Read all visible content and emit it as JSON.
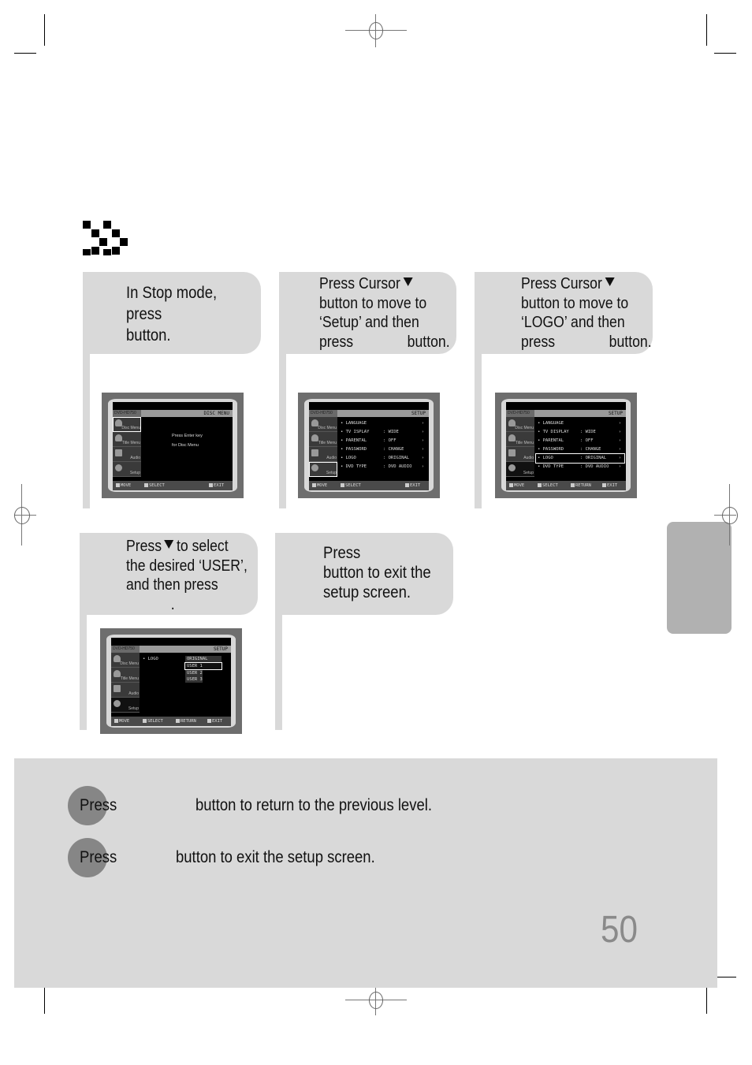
{
  "section_icon": "double-chevron-right-icon",
  "steps": [
    {
      "lines": [
        "In Stop mode,",
        "press",
        "button."
      ],
      "screen": {
        "brand": "DVD-HD750",
        "title": "DISC MENU",
        "sidebar": [
          "Disc Menu",
          "Title Menu",
          "Audio",
          "Setup"
        ],
        "selected_sidebar": "Disc Menu",
        "message": [
          "Press Enter key",
          "for Disc Menu"
        ],
        "footer": [
          "MOVE",
          "SELECT",
          "EXIT"
        ]
      }
    },
    {
      "lines": [
        "Press Cursor",
        "button to move to",
        "‘Setup’ and then",
        "press              button."
      ],
      "arrow": "down-triangle-icon",
      "screen": {
        "brand": "DVD-HD750",
        "title": "SETUP",
        "sidebar": [
          "Disc Menu",
          "Title Menu",
          "Audio",
          "Setup"
        ],
        "selected_sidebar": "Setup",
        "rows": [
          {
            "label": "LANGUAGE",
            "value": ""
          },
          {
            "label": "TV  ISPLAY",
            "value": "WIDE"
          },
          {
            "label": "PARENTAL",
            "value": "OFF"
          },
          {
            "label": "PASSWORD",
            "value": "CHANGE"
          },
          {
            "label": "LOGO",
            "value": "ORIGINAL"
          },
          {
            "label": "DVD TYPE",
            "value": "DVD AUDIO"
          }
        ],
        "footer": [
          "MOVE",
          "SELECT",
          "EXIT"
        ]
      }
    },
    {
      "lines": [
        "Press Cursor",
        "button to move to",
        "‘LOGO’ and then",
        "press              button."
      ],
      "arrow": "down-triangle-icon",
      "screen": {
        "brand": "DVD-HD750",
        "title": "SETUP",
        "sidebar": [
          "Disc Menu",
          "Title Menu",
          "Audio",
          "Setup"
        ],
        "rows": [
          {
            "label": "LANGUAGE",
            "value": ""
          },
          {
            "label": "TV DISPLAY",
            "value": "WIDE"
          },
          {
            "label": "PARENTAL",
            "value": "OFF"
          },
          {
            "label": "PASSWORD",
            "value": "CHANGE"
          },
          {
            "label": "LOGO",
            "value": "ORIGINAL"
          },
          {
            "label": "DVD TYPE",
            "value": "DVD AUDIO"
          }
        ],
        "selected_row": "LOGO",
        "footer": [
          "MOVE",
          "SELECT",
          "RETURN",
          "EXIT"
        ]
      }
    },
    {
      "lines": [
        "Press",
        "to select",
        "the desired ‘USER’,",
        "and then press",
        "."
      ],
      "arrow": "down-triangle-icon",
      "screen": {
        "brand": "DVD-HD750",
        "title": "SETUP",
        "sidebar": [
          "Disc Menu",
          "Title Menu",
          "Audio",
          "Setup"
        ],
        "item": "LOGO",
        "options": [
          "ORIGINAL",
          "USER 1",
          "USER 2",
          "USER 3"
        ],
        "selected_option": "USER 1",
        "footer": [
          "MOVE",
          "SELECT",
          "RETURN",
          "EXIT"
        ]
      }
    },
    {
      "lines": [
        "Press",
        "button to exit the",
        "setup screen."
      ]
    }
  ],
  "notes": [
    {
      "press": "Press",
      "text": "button to return to the previous level."
    },
    {
      "press": "Press",
      "text": "button to exit the setup screen."
    }
  ],
  "page_number": "50"
}
